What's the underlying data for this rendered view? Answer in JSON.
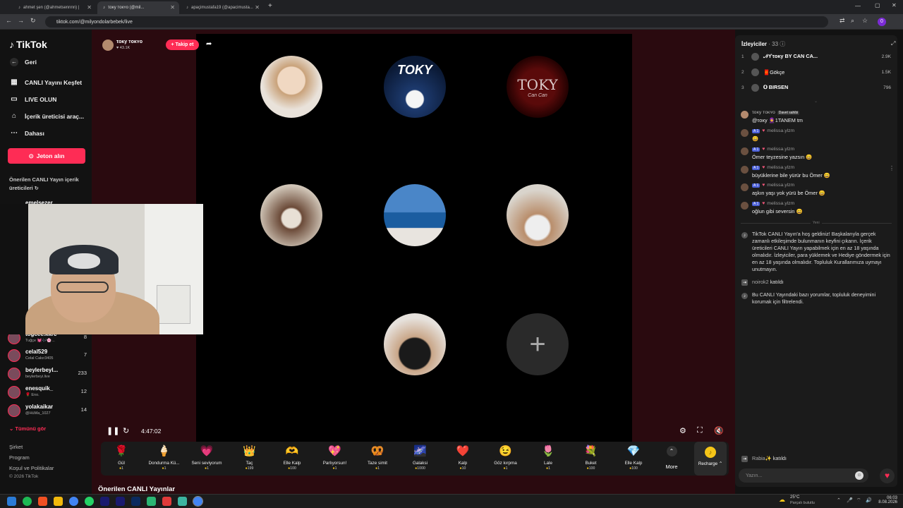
{
  "browser": {
    "tabs": [
      {
        "title": "ahmet şen (@ahmetsennnn) |"
      },
      {
        "title": "τoκy ᴛᴏᴋʏᴏ (@mil..."
      },
      {
        "title": "apaçimustafa19 (@apacimusta..."
      }
    ],
    "url": "tiktok.com/@milyondolarbebek/live",
    "profile_letter": "0"
  },
  "sidebar": {
    "logo": "TikTok",
    "back": "Geri",
    "items": [
      {
        "label": "CANLI Yayını Keşfet",
        "icon": "explore-live-icon"
      },
      {
        "label": "LIVE OLUN",
        "icon": "camera-icon"
      },
      {
        "label": "İçerik üreticisi araç...",
        "icon": "home-icon"
      },
      {
        "label": "Dahası",
        "icon": "more-icon"
      }
    ],
    "coin_button": "Jeton alın",
    "suggested_title": "Önerilen CANLI Yayın içerik üreticileri",
    "partial_name": "emelsezer",
    "followed": [
      {
        "name": "togcee.kkrc",
        "sub": "Tuğçe 💓🎶🌸...",
        "count": "8"
      },
      {
        "name": "celal529",
        "sub": "Celal Cakır3405",
        "count": "7"
      },
      {
        "name": "beylerbeyl...",
        "sub": "beylerbeyi.live",
        "count": "233"
      },
      {
        "name": "enesquik_",
        "sub": "🌹 Eno.",
        "count": "12"
      },
      {
        "name": "yolakaikar",
        "sub": "@HüMa_1027",
        "count": "14"
      }
    ],
    "see_all": "Tümünü gör",
    "footer": [
      "Şirket",
      "Program",
      "Koşul ve Politikalar",
      "© 2026 TikTok"
    ]
  },
  "stream": {
    "host_name": "τoκy ᴛᴏᴋʏᴏ",
    "host_likes": "43.1K",
    "follow_label": "+ Takip et",
    "time": "4:47:02",
    "suggested_heading": "Önerilen CANLI Yayınlar",
    "toky_text": "TOKY",
    "toky_sub": "Can Can"
  },
  "gifts": [
    {
      "name": "Gül",
      "price": "1",
      "icon": "🌹"
    },
    {
      "name": "Dondurma Kü...",
      "price": "1",
      "icon": "🍦"
    },
    {
      "name": "Seni seviyorum",
      "price": "1",
      "icon": "💗"
    },
    {
      "name": "Taç",
      "price": "199",
      "icon": "👑"
    },
    {
      "name": "Elle Kalp",
      "price": "100",
      "icon": "🫶"
    },
    {
      "name": "Parlıyorsun!",
      "price": "1",
      "icon": "💖"
    },
    {
      "name": "Taze simit",
      "price": "1",
      "icon": "🥨"
    },
    {
      "name": "Galaksi",
      "price": "1000",
      "icon": "🌌"
    },
    {
      "name": "Kalp",
      "price": "10",
      "icon": "❤️"
    },
    {
      "name": "Göz kırpma",
      "price": "1",
      "icon": "😉"
    },
    {
      "name": "Lale",
      "price": "1",
      "icon": "🌷"
    },
    {
      "name": "Buket",
      "price": "100",
      "icon": "💐"
    },
    {
      "name": "Elle Kalp",
      "price": "100",
      "icon": "💎"
    }
  ],
  "gift_more": "More",
  "recharge": "Recharge",
  "viewers": {
    "title": "İzleyiciler",
    "count": "· 33",
    "top": [
      {
        "rank": "1",
        "name": "𝒩ϒτoκy BY CAN CA...",
        "score": "2.9K"
      },
      {
        "rank": "2",
        "name": "🧧Gökçe",
        "score": "1.5K"
      },
      {
        "rank": "3",
        "name": "𝐎 BIRSEN",
        "score": "796"
      }
    ]
  },
  "chat": [
    {
      "user": "τoκy ᴛᴏᴋʏᴏ",
      "tag": "Davet sahibi",
      "text": "@τoκy 🧕1TANEM tm"
    },
    {
      "user": "melissa.ylzm",
      "text": "😄"
    },
    {
      "user": "melissa.ylzm",
      "text": "Ömer teyzesine yazsın 😄"
    },
    {
      "user": "melissa.ylzm",
      "text": "büyüklerine bile yürür bu Ömer 😄"
    },
    {
      "user": "melissa.ylzm",
      "text": "aşkın yaşı yok yürü be Ömer 😄"
    },
    {
      "user": "melissa.ylzm",
      "text": "oğlun gibi seversin 😄"
    }
  ],
  "chat_new": "Yeni",
  "system_messages": [
    "TikTok CANLI Yayın'a hoş geldiniz! Başkalarıyla gerçek zamanlı etkileşimde bulunmanın keyfini çıkarın. İçerik üreticileri CANLI Yayın yapabilmek için en az 18 yaşında olmalıdır. İzleyiciler, para yüklemek ve Hediye göndermek için en az 18 yaşında olmalıdır. Topluluk Kurallarımıza uymayı unutmayın.",
    "Bu CANLI Yayındaki bazı yorumlar, topluluk deneyimini korumak için filtrelendi."
  ],
  "joins": [
    {
      "name": "noirok2",
      "action": "katıldı"
    },
    {
      "name": "Rabia✨",
      "action": "katıldı"
    }
  ],
  "chat_placeholder": "Yazın...",
  "taskbar": {
    "weather_temp": "25°C",
    "weather_desc": "Parçalı bulutlu",
    "time": "06:03",
    "date": "8.08.2026"
  },
  "colors": {
    "accent": "#fe2c55",
    "stage": "#2a0a0f"
  }
}
